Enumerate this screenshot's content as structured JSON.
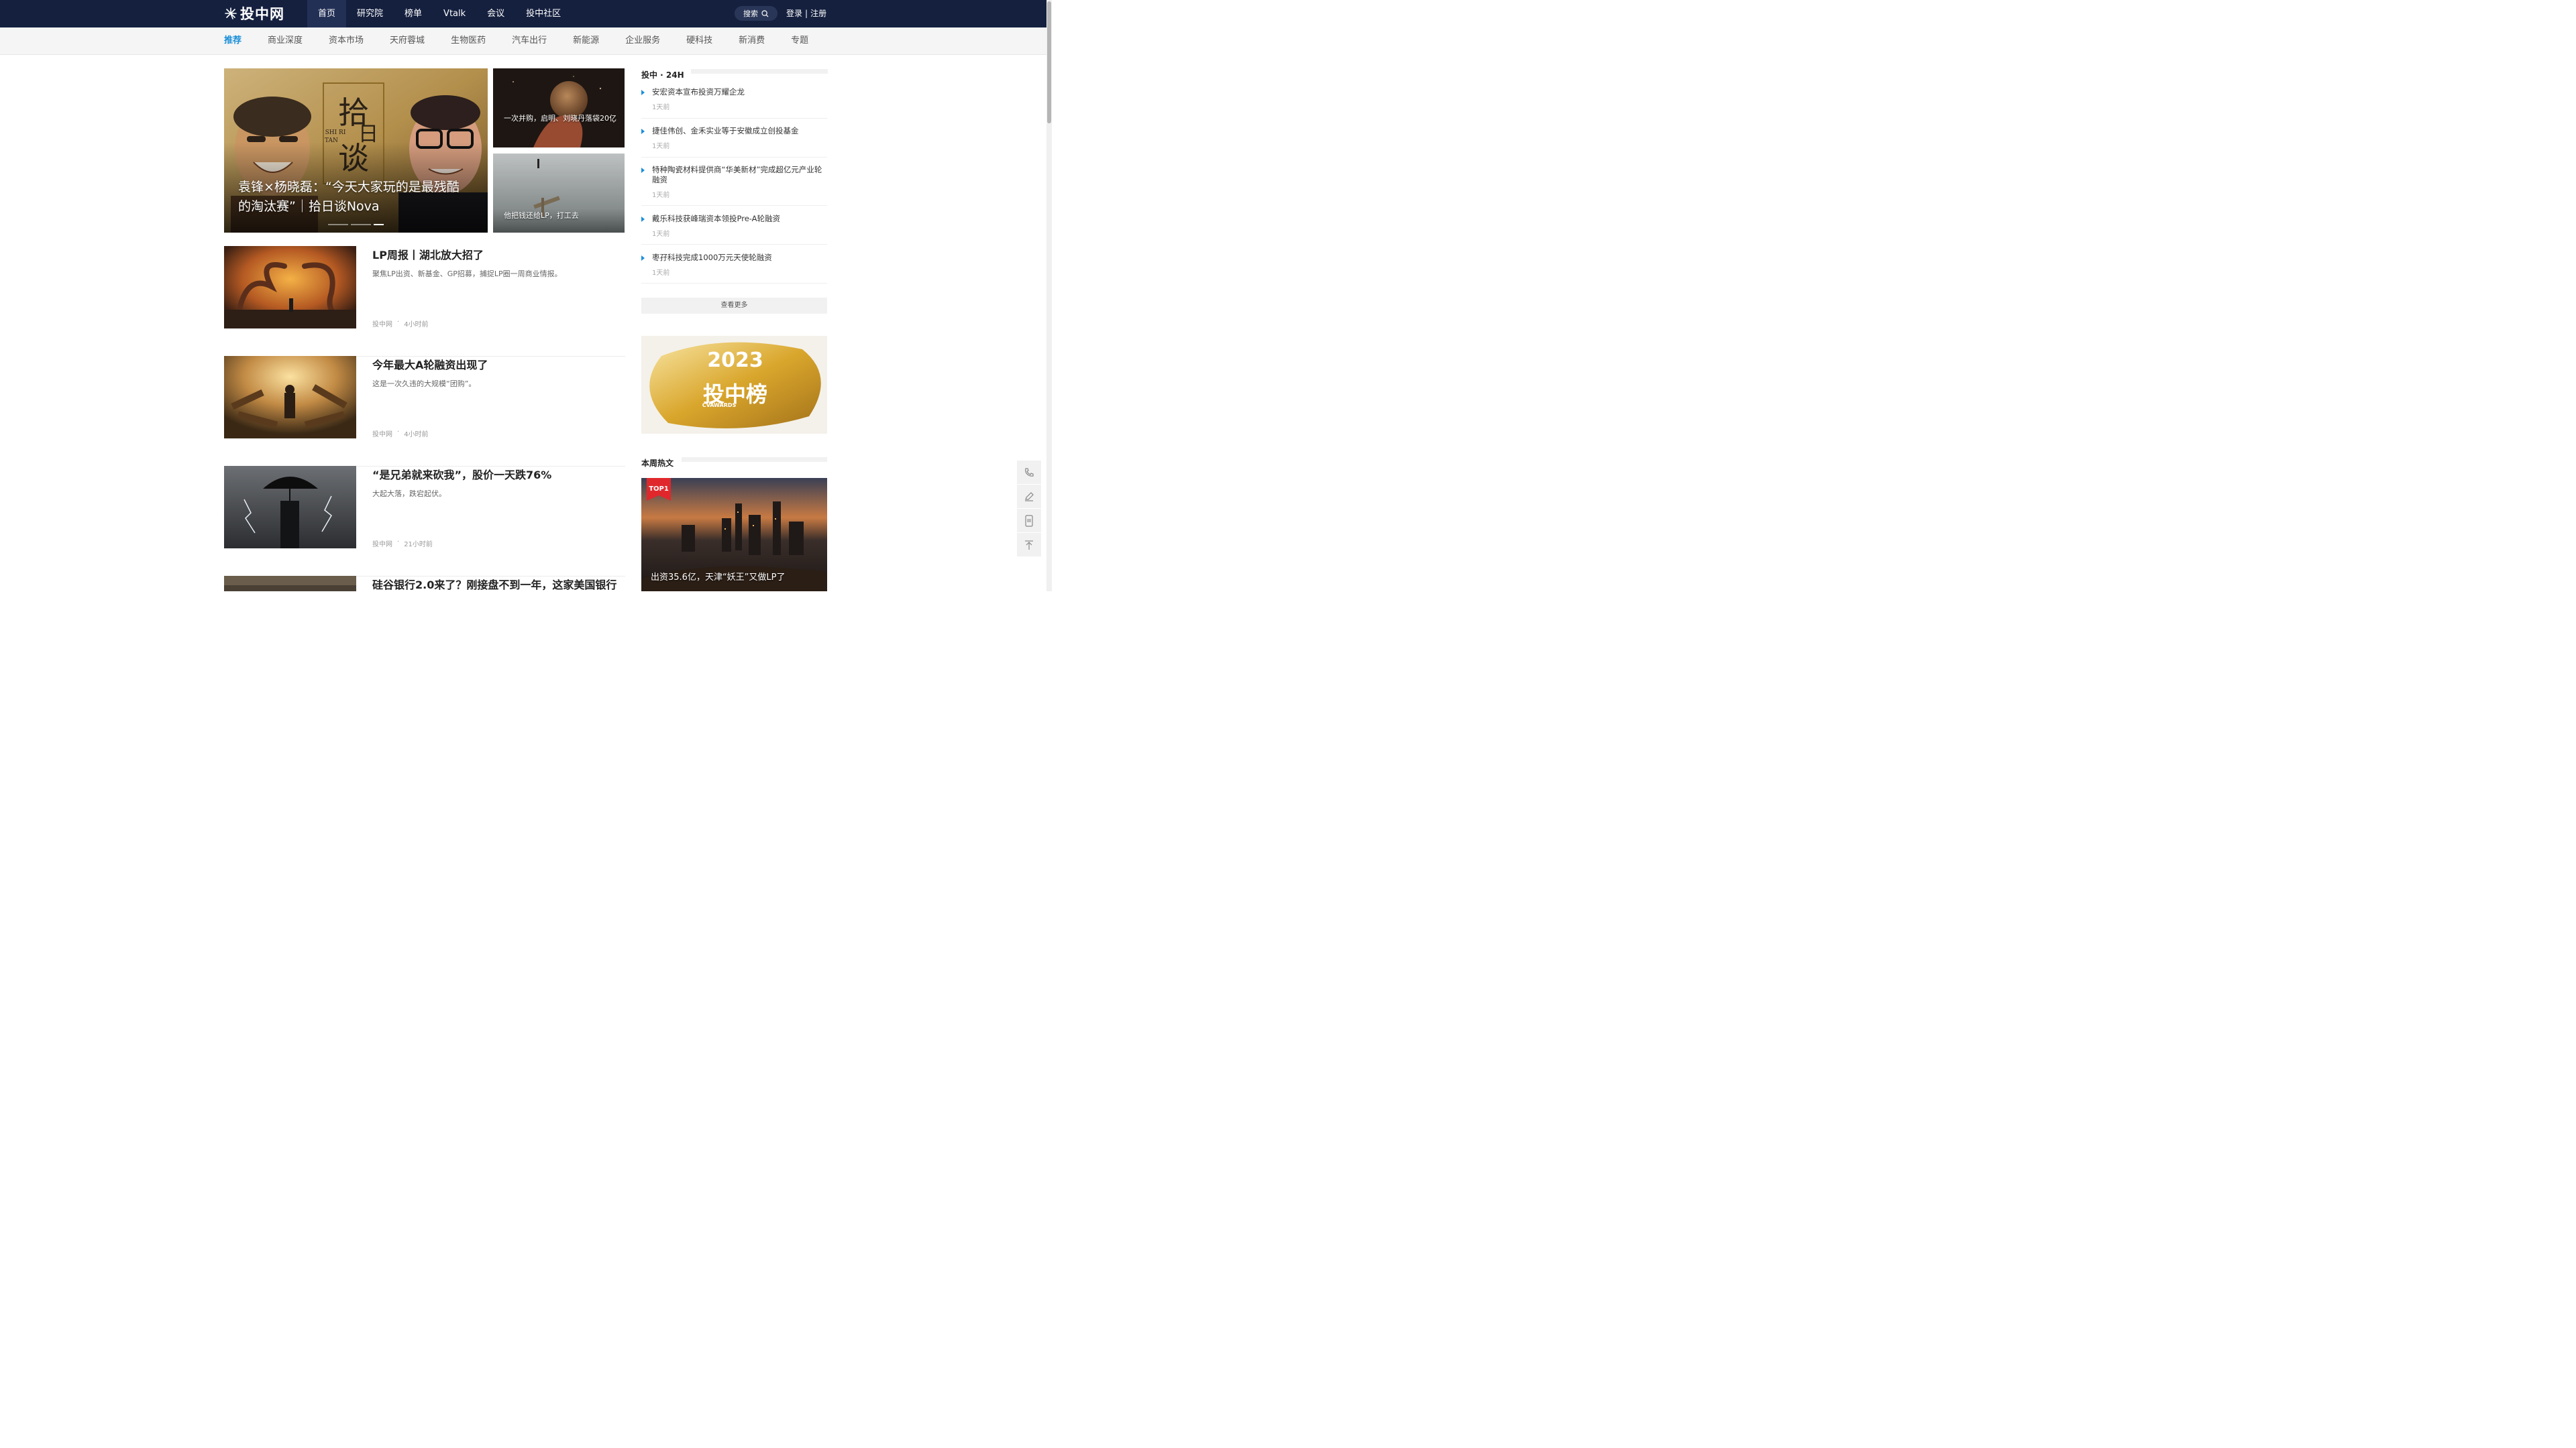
{
  "brand": {
    "name": "投中网"
  },
  "main_nav": [
    {
      "label": "首页",
      "active": true
    },
    {
      "label": "研究院"
    },
    {
      "label": "榜单"
    },
    {
      "label": "Vtalk"
    },
    {
      "label": "会议"
    },
    {
      "label": "投中社区"
    }
  ],
  "search": {
    "label": "搜索",
    "icon": "search-icon"
  },
  "auth": {
    "login": "登录",
    "separator": "|",
    "register": "注册"
  },
  "sub_nav": [
    {
      "label": "推荐",
      "active": true
    },
    {
      "label": "商业深度"
    },
    {
      "label": "资本市场"
    },
    {
      "label": "天府蓉城"
    },
    {
      "label": "生物医药"
    },
    {
      "label": "汽车出行"
    },
    {
      "label": "新能源"
    },
    {
      "label": "企业服务"
    },
    {
      "label": "硬科技"
    },
    {
      "label": "新消费"
    },
    {
      "label": "专题"
    }
  ],
  "hero": {
    "line1": "袁锋×杨晓磊：“今天大家玩的是最残酷",
    "line2": "的淘汰赛”｜拾日谈Nova",
    "art_text": {
      "big": "拾日谈",
      "pinyin1": "SHI RI",
      "pinyin2": "TAN"
    }
  },
  "side_cards": [
    {
      "caption": "一次并购，启明、刘晓丹落袋20亿"
    },
    {
      "caption": "他把钱还给LP，打工去"
    }
  ],
  "articles": [
    {
      "title": "LP周报丨湖北放大招了",
      "summary": "聚焦LP出资、新基金、GP招募，捕捉LP圈一周商业情报。",
      "source": "投中网",
      "dot": "·",
      "time": "4小时前"
    },
    {
      "title": "今年最大A轮融资出现了",
      "summary": "这是一次久违的大规模“团购”。",
      "source": "投中网",
      "dot": "·",
      "time": "4小时前"
    },
    {
      "title": "“是兄弟就来砍我”，股价一天跌76%",
      "summary": "大起大落，跌宕起伏。",
      "source": "投中网",
      "dot": "·",
      "time": "21小时前"
    },
    {
      "title": "硅谷银行2.0来了？刚接盘不到一年，这家美国银行",
      "summary": "",
      "source": "",
      "dot": "",
      "time": ""
    }
  ],
  "news24": {
    "title": "投中 · 24H",
    "items": [
      {
        "title": "安宏资本宣布投资万耀企龙",
        "time": "1天前"
      },
      {
        "title": "捷佳伟创、金禾实业等于安徽成立创投基金",
        "time": "1天前"
      },
      {
        "title": "特种陶瓷材料提供商“华美新材”完成超亿元产业轮融资",
        "time": "1天前"
      },
      {
        "title": "戴乐科技获峰瑞资本领投Pre-A轮融资",
        "time": "1天前"
      },
      {
        "title": "枣孖科技完成1000万元天使轮融资",
        "time": "1天前"
      }
    ],
    "more": "查看更多"
  },
  "banner": {
    "year": "2023",
    "title": "投中榜",
    "sub": "CVAWARDS"
  },
  "hot": {
    "title": "本周热文",
    "badge": "TOP1",
    "caption": "出资35.6亿，天津“妖王”又做LP了"
  },
  "float_tools": [
    "phone-icon",
    "edit-icon",
    "app-icon",
    "back-to-top-icon"
  ],
  "colors": {
    "nav_bg": "#15203f",
    "accent": "#1a8fd8",
    "badge": "#e0282c"
  }
}
